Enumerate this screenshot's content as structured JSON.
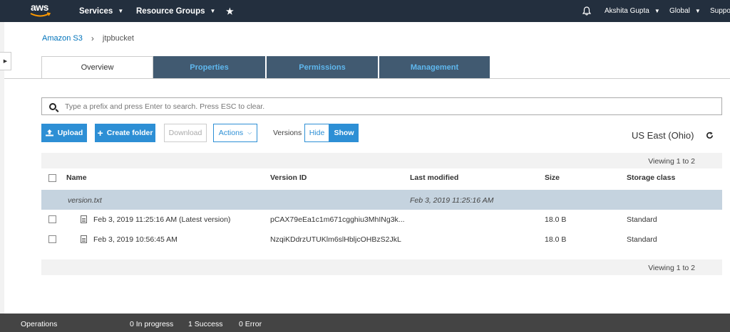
{
  "topnav": {
    "logo": "aws",
    "services": "Services",
    "resource_groups": "Resource Groups",
    "user": "Akshita Gupta",
    "region_menu": "Global",
    "support": "Suppo"
  },
  "breadcrumb": {
    "root": "Amazon S3",
    "separator": "›",
    "bucket": "jtpbucket"
  },
  "tabs": [
    {
      "label": "Overview"
    },
    {
      "label": "Properties"
    },
    {
      "label": "Permissions"
    },
    {
      "label": "Management"
    }
  ],
  "search": {
    "placeholder": "Type a prefix and press Enter to search. Press ESC to clear.",
    "value": ""
  },
  "toolbar": {
    "upload": "Upload",
    "create_folder": "Create folder",
    "download": "Download",
    "actions": "Actions",
    "versions_label": "Versions",
    "hide": "Hide",
    "show": "Show"
  },
  "region": "US East (Ohio)",
  "viewing_text": "Viewing 1 to 2",
  "table": {
    "headers": [
      "Name",
      "Version ID",
      "Last modified",
      "Size",
      "Storage class"
    ],
    "group": {
      "name": "version.txt",
      "last_modified": "Feb 3, 2019 11:25:16 AM"
    },
    "rows": [
      {
        "name": "Feb 3, 2019 11:25:16 AM (Latest version)",
        "version_id": "pCAX79eEa1c1m671cgghiu3MhINg3k...",
        "size": "18.0 B",
        "storage_class": "Standard"
      },
      {
        "name": "Feb 3, 2019 10:56:45 AM",
        "version_id": "NzqiKDdrzUTUKlm6slHbljcOHBzS2JkL",
        "size": "18.0 B",
        "storage_class": "Standard"
      }
    ]
  },
  "operations": {
    "label": "Operations",
    "in_progress": "0 In progress",
    "success": "1 Success",
    "error": "0 Error"
  },
  "colors": {
    "nav_bg": "#232f3e",
    "accent": "#2d8fd5",
    "tab_bg": "#415a71",
    "group_row": "#c5d3df",
    "bottom_bar": "#444444"
  }
}
